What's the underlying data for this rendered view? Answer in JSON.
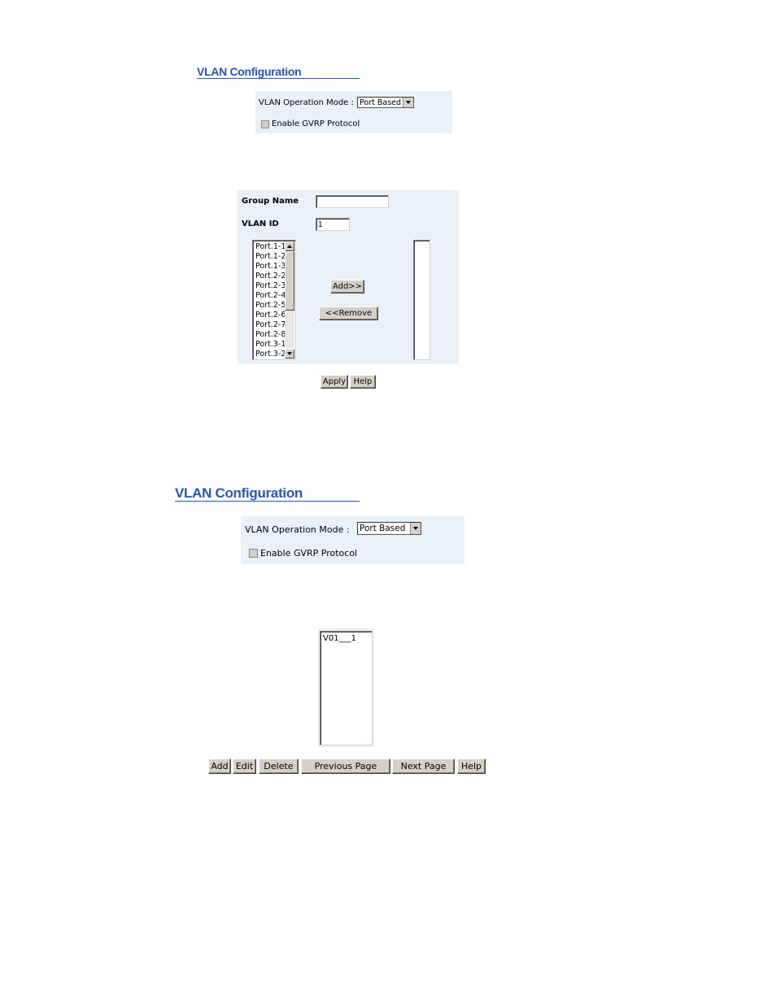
{
  "screen1": {
    "title": "VLAN Configuration",
    "mode_label": "VLAN Operation Mode :",
    "mode_value": "Port Based",
    "gvrp_label": "Enable GVRP Protocol",
    "gvrp_checked": false,
    "group_name_label": "Group Name",
    "group_name_value": "",
    "vlan_id_label": "VLAN ID",
    "vlan_id_value": "1",
    "available_ports": [
      "Port.1-1",
      "Port.1-2",
      "Port.1-3",
      "Port.2-2",
      "Port.2-3",
      "Port.2-4",
      "Port.2-5",
      "Port.2-6",
      "Port.2-7",
      "Port.2-8",
      "Port.3-1",
      "Port.3-2"
    ],
    "selected_ports": [],
    "add_button": "Add>>",
    "remove_button": "<<Remove",
    "apply_button": "Apply",
    "help_button": "Help"
  },
  "screen2": {
    "title": "VLAN Configuration",
    "mode_label": "VLAN Operation Mode :",
    "mode_value": "Port Based",
    "gvrp_label": "Enable GVRP Protocol",
    "gvrp_checked": false,
    "vlan_list": [
      "V01___1"
    ],
    "buttons": {
      "add": "Add",
      "edit": "Edit",
      "delete": "Delete",
      "previous_page": "Previous Page",
      "next_page": "Next Page",
      "help": "Help"
    }
  },
  "colors": {
    "title": "#2455b7",
    "panel_bg": "#eaf0f8",
    "button_face": "#d4d0c8"
  }
}
